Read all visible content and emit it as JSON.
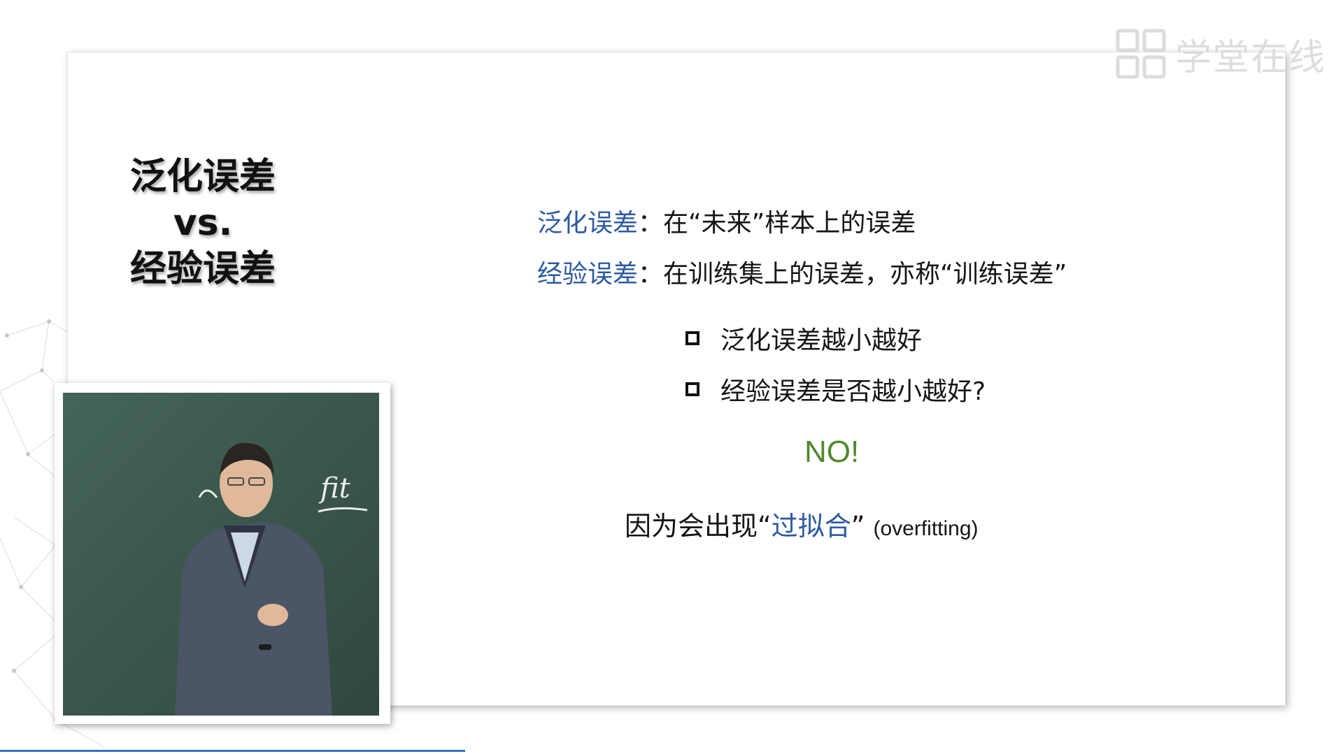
{
  "title": {
    "line1": "泛化误差",
    "line2": "vs.",
    "line3": "经验误差"
  },
  "definitions": [
    {
      "term": "泛化误差",
      "text": "：在“未来”样本上的误差"
    },
    {
      "term": "经验误差",
      "text": "：在训练集上的误差，亦称“训练误差”"
    }
  ],
  "questions": [
    {
      "text": "泛化误差越小越好"
    },
    {
      "text": "经验误差是否越小越好?"
    }
  ],
  "answer": "NO!",
  "reason": {
    "prefix": "因为会出现“",
    "term": "过拟合",
    "suffix": "”",
    "english": "(overfitting)"
  },
  "watermark": "学堂在线",
  "board_text": "fit",
  "icons": {
    "logo": "xuetangx-logo-icon",
    "checkbox": "checkbox-icon"
  },
  "colors": {
    "term_blue": "#2d5aa0",
    "answer_green": "#4f8a2c",
    "chalkboard": "#3d5a4e"
  }
}
